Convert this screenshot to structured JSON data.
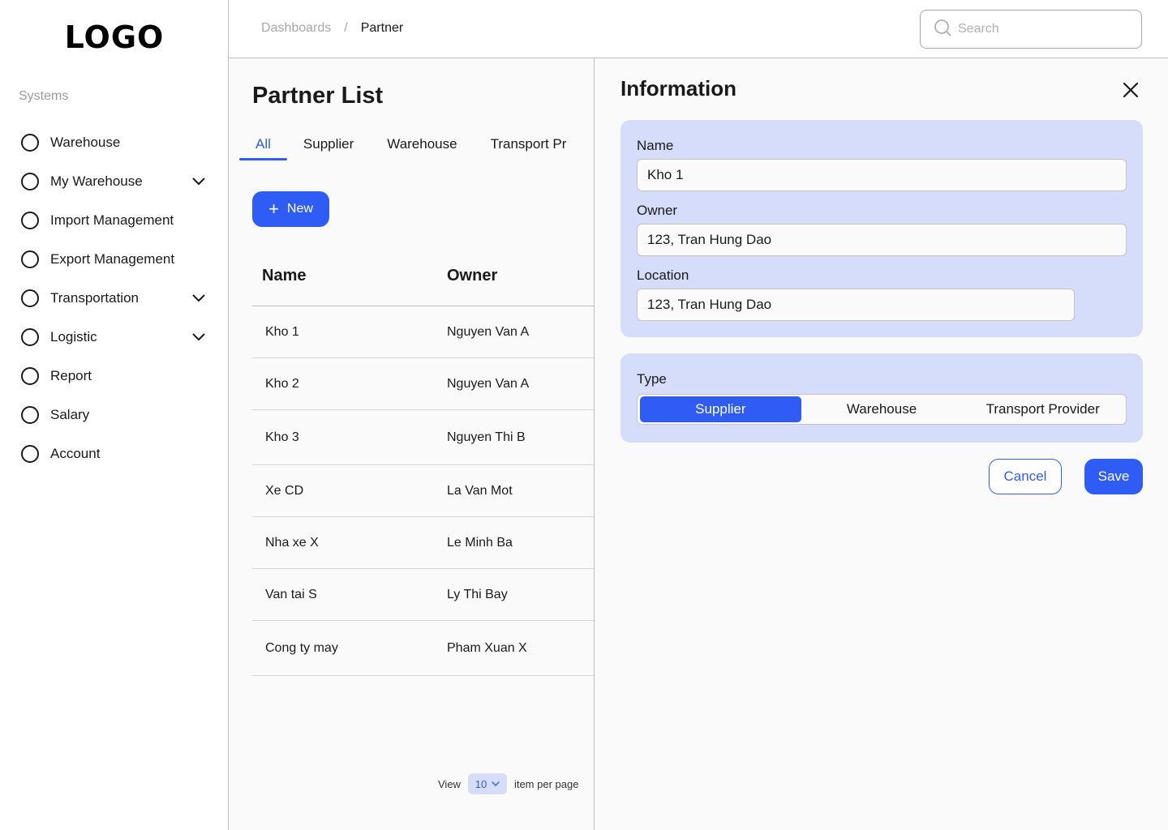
{
  "logo": "LOGO",
  "sidebar": {
    "section_label": "Systems",
    "items": [
      {
        "label": "Warehouse",
        "has_chevron": false
      },
      {
        "label": "My Warehouse",
        "has_chevron": true
      },
      {
        "label": "Import Management",
        "has_chevron": false
      },
      {
        "label": "Export Management",
        "has_chevron": false
      },
      {
        "label": "Transportation",
        "has_chevron": true
      },
      {
        "label": "Logistic",
        "has_chevron": true
      },
      {
        "label": "Report",
        "has_chevron": false
      },
      {
        "label": "Salary",
        "has_chevron": false
      },
      {
        "label": "Account",
        "has_chevron": false
      }
    ]
  },
  "header": {
    "breadcrumb": [
      "Dashboards",
      "Partner"
    ],
    "separator": "/",
    "search_placeholder": "Search"
  },
  "main": {
    "title": "Partner List",
    "tabs": [
      "All",
      "Supplier",
      "Warehouse",
      "Transport Pr"
    ],
    "active_tab": "All",
    "new_button": "New",
    "columns": [
      "Name",
      "Owner"
    ],
    "rows": [
      {
        "name": "Kho 1",
        "owner": "Nguyen Van A"
      },
      {
        "name": "Kho 2",
        "owner": "Nguyen Van A"
      },
      {
        "name": "Kho 3",
        "owner": "Nguyen Thi B"
      },
      {
        "name": "Xe CD",
        "owner": "La Van Mot"
      },
      {
        "name": "Nha xe X",
        "owner": "Le Minh Ba"
      },
      {
        "name": "Van tai S",
        "owner": "Ly Thi Bay"
      },
      {
        "name": "Cong ty may",
        "owner": "Pham Xuan X"
      }
    ],
    "pager": {
      "view_label": "View",
      "per_page": "10",
      "suffix": "item per page"
    }
  },
  "info": {
    "title": "Information",
    "fields": {
      "name_label": "Name",
      "name_value": "Kho 1",
      "owner_label": "Owner",
      "owner_value": "123, Tran Hung Dao",
      "location_label": "Location",
      "location_value": "123, Tran Hung Dao"
    },
    "type_label": "Type",
    "type_options": [
      "Supplier",
      "Warehouse",
      "Transport Provider"
    ],
    "type_selected": "Supplier",
    "cancel_label": "Cancel",
    "save_label": "Save"
  },
  "colors": {
    "accent": "#2f5cf5",
    "card_bg": "#d6ddfb",
    "muted": "#a8a8a8"
  }
}
